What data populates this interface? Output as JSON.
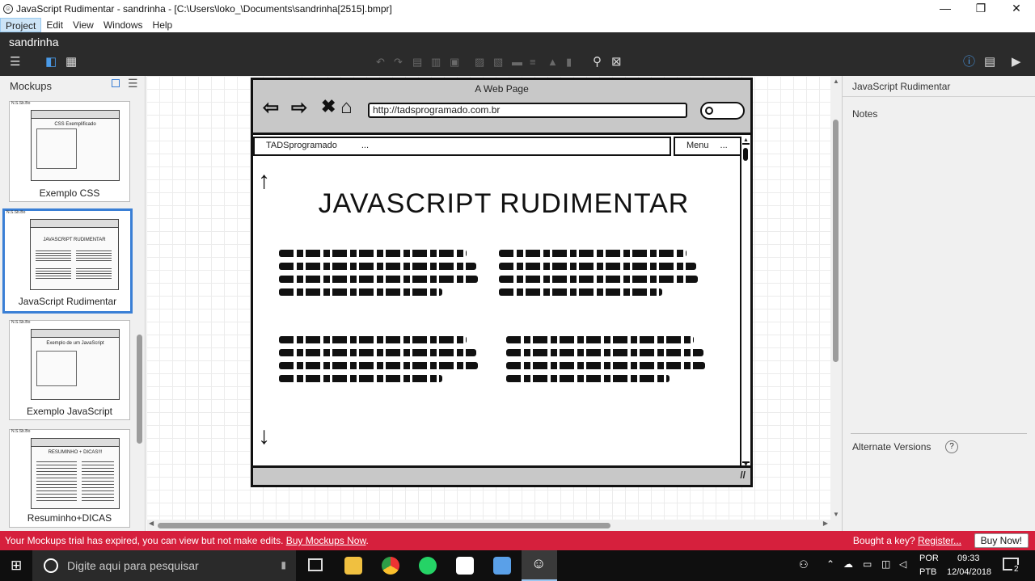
{
  "window": {
    "title": "JavaScript Rudimentar - sandrinha - [C:\\Users\\loko_\\Documents\\sandrinha[2515].bmpr]",
    "min_glyph": "—",
    "restore_glyph": "❐",
    "close_glyph": "✕"
  },
  "menu": [
    "Project",
    "Edit",
    "View",
    "Windows",
    "Help"
  ],
  "project_name": "sandrinha",
  "left_panel": {
    "title": "Mockups",
    "items": [
      {
        "caption": "Exemplo CSS",
        "thumb_title": "CSS Exemplificado"
      },
      {
        "caption": "JavaScript Rudimentar",
        "thumb_title": "JAVASCRIPT RUDIMENTAR"
      },
      {
        "caption": "Exemplo JavaScript",
        "thumb_title": "Exemplo de um JavaScript"
      },
      {
        "caption": "Resuminho+DICAS",
        "thumb_title": "RESUMINHO + DICAS!!!"
      }
    ],
    "thumb_tag": "N.S.Sb.Bo"
  },
  "mockup": {
    "page_title": "A Web Page",
    "url": "http://tadsprogramado.com.br",
    "nav_left": "TADSprogramado",
    "nav_left_more": "...",
    "nav_right": "Menu",
    "nav_right_more": "...",
    "heading": "JAVASCRIPT RUDIMENTAR"
  },
  "right_panel": {
    "title": "JavaScript Rudimentar",
    "notes_label": "Notes",
    "alt_versions_label": "Alternate Versions",
    "help_glyph": "?"
  },
  "trial": {
    "message": "Your Mockups trial has expired, you can view but not make edits.",
    "buy_link": "Buy Mockups Now",
    "question": "Bought a key?",
    "register_link": "Register...",
    "buy_button": "Buy Now!"
  },
  "taskbar": {
    "search_placeholder": "Digite aqui para pesquisar",
    "lang_top": "POR",
    "lang_bottom": "PTB",
    "time": "09:33",
    "date": "12/04/2018",
    "notif_count": "2"
  },
  "colors": {
    "accent": "#3a7fd5",
    "trial_bar": "#d6203d",
    "app_bar": "#2b2b2b"
  }
}
